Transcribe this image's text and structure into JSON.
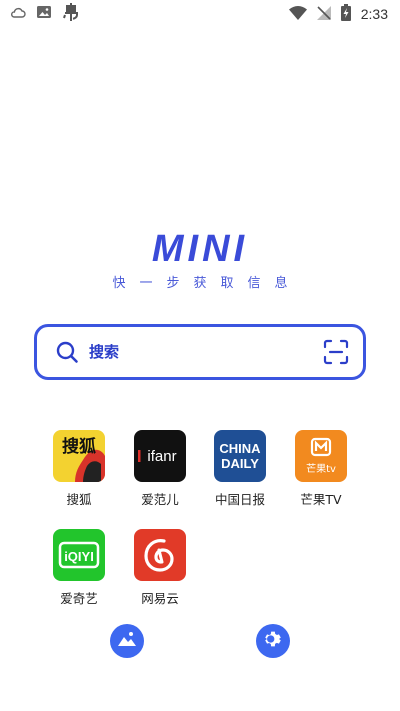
{
  "status_bar": {
    "time": "2:33",
    "left_icons": [
      "cloud-icon",
      "image-icon",
      "bug-icon"
    ],
    "right_icons": [
      "wifi-icon",
      "no-signal-icon",
      "battery-charging-icon"
    ]
  },
  "logo": {
    "title": "MINI",
    "tagline": "快一步获取信息"
  },
  "search": {
    "placeholder": "搜索",
    "search_icon": "search-icon",
    "scan_icon": "scan-icon"
  },
  "apps": [
    {
      "label": "搜狐",
      "icon": "sohu-logo",
      "color": "#f3d230",
      "icon_text": "搜狐"
    },
    {
      "label": "爱范儿",
      "icon": "ifanr-logo",
      "color": "#111111",
      "icon_text": "ifanr"
    },
    {
      "label": "中国日报",
      "icon": "chinadaily-logo",
      "color": "#1f4f95",
      "icon_text_1": "CHINA",
      "icon_text_2": "DAILY"
    },
    {
      "label": "芒果TV",
      "icon": "mango-tv-logo",
      "color": "#f28a1f",
      "icon_text": "芒果tv"
    },
    {
      "label": "爱奇艺",
      "icon": "iqiyi-logo",
      "color": "#22c52c",
      "icon_text": "iQIYI"
    },
    {
      "label": "网易云",
      "icon": "netease-music-logo",
      "color": "#e13a28"
    }
  ],
  "bottom": {
    "left_icon": "gallery-icon",
    "right_icon": "settings-icon"
  },
  "colors": {
    "accent": "#3b55e0",
    "logo": "#3a4bd8"
  }
}
